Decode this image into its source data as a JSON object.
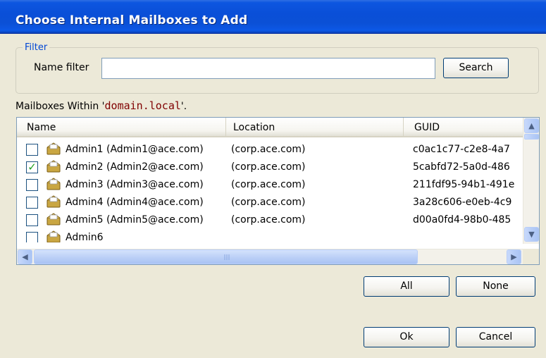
{
  "window": {
    "title": "Choose Internal Mailboxes to Add"
  },
  "filter": {
    "legend": "Filter",
    "name_filter_label": "Name filter",
    "name_filter_value": "",
    "search_label": "Search"
  },
  "mailboxes": {
    "caption_prefix": "Mailboxes Within '",
    "domain": "domain.local",
    "caption_suffix": "'.",
    "columns": {
      "name": "Name",
      "location": "Location",
      "guid": "GUID"
    },
    "rows": [
      {
        "checked": false,
        "name": "Admin1",
        "email": "(Admin1@ace.com)",
        "location": "(corp.ace.com)",
        "guid": "c0ac1c77-c2e8-4a7"
      },
      {
        "checked": true,
        "name": "Admin2",
        "email": "(Admin2@ace.com)",
        "location": "(corp.ace.com)",
        "guid": "5cabfd72-5a0d-486"
      },
      {
        "checked": false,
        "name": "Admin3",
        "email": "(Admin3@ace.com)",
        "location": "(corp.ace.com)",
        "guid": "211fdf95-94b1-491e"
      },
      {
        "checked": false,
        "name": "Admin4",
        "email": "(Admin4@ace.com)",
        "location": "(corp.ace.com)",
        "guid": "3a28c606-e0eb-4c9"
      },
      {
        "checked": false,
        "name": "Admin5",
        "email": "(Admin5@ace.com)",
        "location": "(corp.ace.com)",
        "guid": "d00a0fd4-98b0-485"
      },
      {
        "checked": false,
        "name": "Admin6",
        "email": "",
        "location": "",
        "guid": ""
      }
    ]
  },
  "buttons": {
    "all": "All",
    "none": "None",
    "ok": "Ok",
    "cancel": "Cancel"
  }
}
